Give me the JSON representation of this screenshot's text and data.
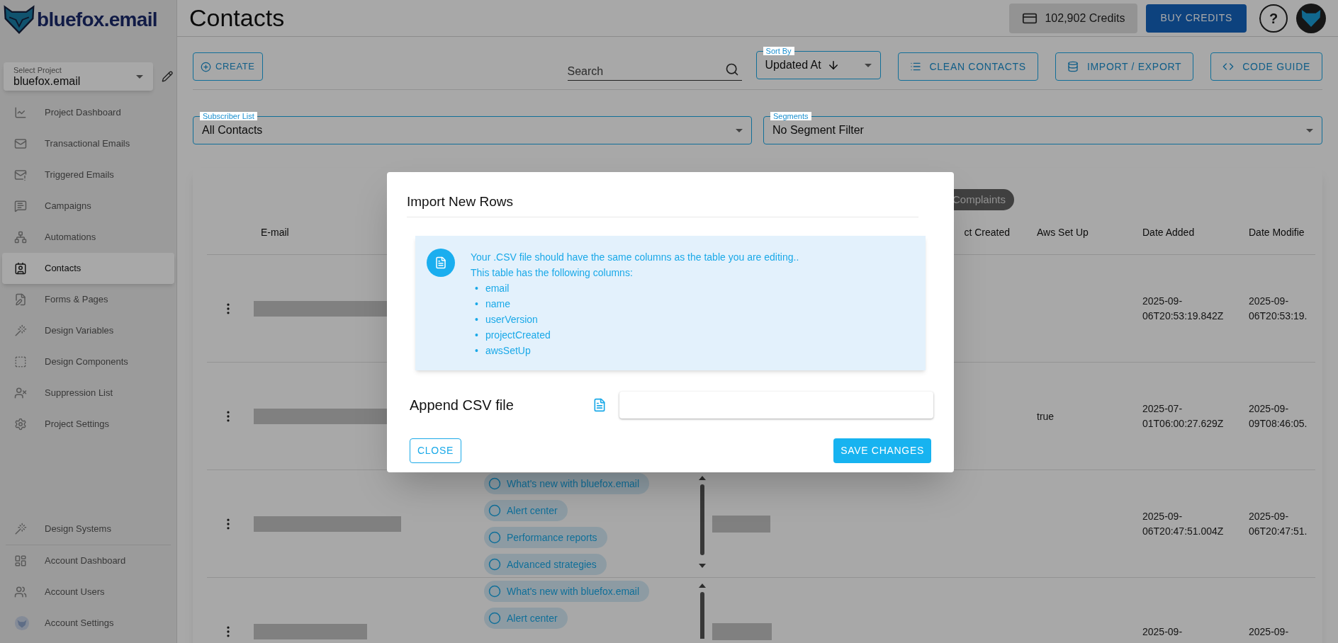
{
  "brand": {
    "name": "bluefox.email"
  },
  "project_select": {
    "label": "Select Project",
    "value": "bluefox.email"
  },
  "sidebar": {
    "items": [
      {
        "label": "Project Dashboard",
        "selected": false
      },
      {
        "label": "Transactional Emails",
        "selected": false
      },
      {
        "label": "Triggered Emails",
        "selected": false
      },
      {
        "label": "Campaigns",
        "selected": false
      },
      {
        "label": "Automations",
        "selected": false
      },
      {
        "label": "Contacts",
        "selected": true
      },
      {
        "label": "Forms & Pages",
        "selected": false
      },
      {
        "label": "Design Variables",
        "selected": false
      },
      {
        "label": "Design Components",
        "selected": false
      },
      {
        "label": "Suppression List",
        "selected": false
      },
      {
        "label": "Project Settings",
        "selected": false
      }
    ],
    "bottom_items": [
      {
        "label": "Design Systems",
        "selected": false
      },
      {
        "label": "Account Dashboard",
        "selected": false
      },
      {
        "label": "Account Users",
        "selected": false
      },
      {
        "label": "Account Settings",
        "selected": false
      }
    ]
  },
  "header": {
    "title": "Contacts",
    "credits": "102,902 Credits",
    "buy_button": "BUY CREDITS",
    "help": "?"
  },
  "toolbar": {
    "create": "CREATE",
    "search": {
      "placeholder": "Search"
    },
    "sort": {
      "label": "Sort By",
      "value": "Updated At"
    },
    "buttons": [
      "CLEAN CONTACTS",
      "IMPORT / EXPORT",
      "CODE GUIDE"
    ]
  },
  "filters": [
    {
      "label": "Subscriber List",
      "value": "All Contacts"
    },
    {
      "label": "Segments",
      "value": "No Segment Filter"
    }
  ],
  "table": {
    "filter_chip": "Complaints",
    "columns": [
      "E-mail",
      "ct Created",
      "Aws Set Up",
      "Date Added",
      "Date Modifie"
    ],
    "rows": [
      {
        "email": {
          "kind": "redacted"
        },
        "tags": [],
        "aws": "",
        "date_added": "2025-09-06T20:53:19.842Z",
        "date_modified": "2025-09-06T20:53:19."
      },
      {
        "email": {
          "kind": "redacted"
        },
        "tags": [],
        "aws": "true",
        "date_added": "2025-07-01T06:00:27.629Z",
        "date_modified": "2025-09-09T08:46:05."
      },
      {
        "email": {
          "kind": "redacted"
        },
        "name": {
          "kind": "redacted"
        },
        "tags": [
          "What's new with bluefox.email",
          "Alert center",
          "Performance reports",
          "Advanced strategies"
        ],
        "aws": "",
        "date_added": "2025-09-06T20:47:51.004Z",
        "date_modified": "2025-09-06T20:47:51."
      },
      {
        "email": {
          "kind": "redacted"
        },
        "name": {
          "kind": "redacted"
        },
        "tags": [
          "What's new with bluefox.email",
          "Alert center"
        ],
        "aws": "",
        "date_added": "2025-09-",
        "date_modified": "2025-09-"
      }
    ]
  },
  "dialog": {
    "title": "Import New Rows",
    "info_lines": [
      "Your .CSV file should have the same columns as the table you are editing..",
      "This table has the following columns:"
    ],
    "columns": [
      {
        "bullet": "•",
        "name": "email"
      },
      {
        "bullet": "•",
        "name": "name"
      },
      {
        "bullet": "•",
        "name": "userVersion"
      },
      {
        "bullet": "•",
        "name": "projectCreated"
      },
      {
        "bullet": "•",
        "name": "awsSetUp"
      }
    ],
    "file_label": "Append CSV file",
    "buttons": [
      {
        "label": "CLOSE",
        "kind": "outlined"
      },
      {
        "label": "SAVE CHANGES",
        "kind": "contained"
      }
    ]
  }
}
